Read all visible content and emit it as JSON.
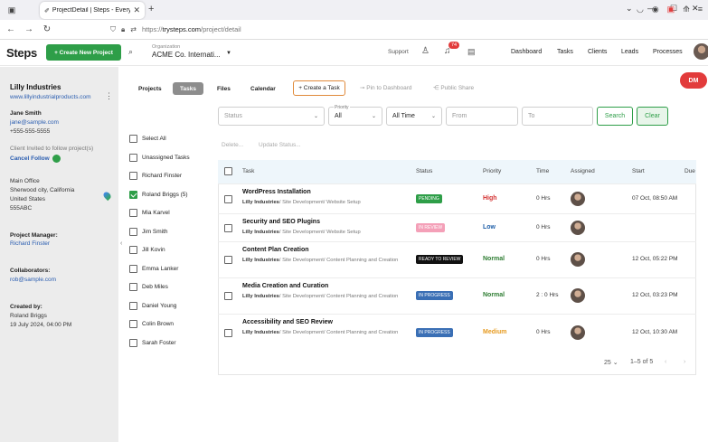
{
  "browser": {
    "tab_title": "ProjectDetail | Steps - Everythin",
    "url_prefix": "https://",
    "url_domain": "trysteps.com",
    "url_path": "/project/detail"
  },
  "header": {
    "logo": "Steps",
    "create_project": "+ Create New Project",
    "org_label": "Organization",
    "org_name": "ACME Co. Internati...",
    "support": "Support",
    "notif_count": "74",
    "nav": [
      "Dashboard",
      "Tasks",
      "Clients",
      "Leads",
      "Processes"
    ]
  },
  "sidebar": {
    "client_name": "Lilly Industries",
    "client_url": "www.lillyindustrialproducts.com",
    "contact_name": "Jane Smith",
    "contact_email": "jane@sample.com",
    "contact_phone": "+555-555-5555",
    "invite_note": "Client Invited to follow project(s)",
    "cancel_follow": "Cancel Follow",
    "address": [
      "Main Office",
      "Sherwood city, California",
      "United States",
      "555ABC"
    ],
    "pm_label": "Project Manager:",
    "pm_name": "Richard Finster",
    "collab_label": "Collaborators:",
    "collab_email": "rob@sample.com",
    "created_label": "Created by:",
    "created_name": "Roland Briggs",
    "created_date": "19 July 2024, 04:00 PM"
  },
  "project_tabs": [
    "Projects",
    "Tasks",
    "Files",
    "Calendar"
  ],
  "actions": {
    "create_task": "+ Create a Task",
    "pin": "Pin to Dashboard",
    "share": "Public Share"
  },
  "filters": {
    "status_placeholder": "Status",
    "priority_label": "Priority",
    "priority_value": "All",
    "time_value": "All Time",
    "from_placeholder": "From",
    "to_placeholder": "To",
    "search": "Search",
    "clear": "Clear"
  },
  "assignees": [
    {
      "name": "Select All",
      "checked": false
    },
    {
      "name": "Unassigned Tasks",
      "checked": false
    },
    {
      "name": "Richard Finster",
      "checked": false
    },
    {
      "name": "Roland Briggs (5)",
      "checked": true
    },
    {
      "name": "Mia Karvel",
      "checked": false
    },
    {
      "name": "Jim Smith",
      "checked": false
    },
    {
      "name": "Jill Kovin",
      "checked": false
    },
    {
      "name": "Emma Lanker",
      "checked": false
    },
    {
      "name": "Deb Miles",
      "checked": false
    },
    {
      "name": "Daniel Young",
      "checked": false
    },
    {
      "name": "Colin Brown",
      "checked": false
    },
    {
      "name": "Sarah Foster",
      "checked": false
    }
  ],
  "bulk": {
    "delete": "Delete...",
    "update": "Update Status..."
  },
  "table": {
    "columns": [
      "Task",
      "Status",
      "Priority",
      "Time",
      "Assigned",
      "Start",
      "Due"
    ],
    "rows": [
      {
        "title": "WordPress Installation",
        "client": "Lilly Industries",
        "path": "/ Site Development/ Website Setup",
        "status": "PENDING",
        "status_color": "#2e9e48",
        "priority": "High",
        "priority_color": "#d32f2f",
        "time": "0 Hrs",
        "start": "07 Oct, 08:50 AM"
      },
      {
        "title": "Security and SEO Plugins",
        "client": "Lilly Industries",
        "path": "/ Site Development/ Website Setup",
        "status": "IN REVIEW",
        "status_color": "#f4a0b8",
        "priority": "Low",
        "priority_color": "#1f5fa8",
        "time": "0 Hrs",
        "start": ""
      },
      {
        "title": "Content Plan Creation",
        "client": "Lilly Industries",
        "path": "/ Site Development/ Content Planning and Creation",
        "status": "READY TO REVIEW",
        "status_color": "#111111",
        "priority": "Normal",
        "priority_color": "#2e7d32",
        "time": "0 Hrs",
        "start": "12 Oct, 05:22 PM"
      },
      {
        "title": "Media Creation and Curation",
        "client": "Lilly Industries",
        "path": "/ Site Development/ Content Planning and Creation",
        "status": "IN PROGRESS",
        "status_color": "#3a6fb5",
        "priority": "Normal",
        "priority_color": "#2e7d32",
        "time": "2 : 0 Hrs",
        "start": "12 Oct, 03:23 PM"
      },
      {
        "title": "Accessibility and SEO Review",
        "client": "Lilly Industries",
        "path": "/ Site Development/ Content Planning and Creation",
        "status": "IN PROGRESS",
        "status_color": "#3a6fb5",
        "priority": "Medium",
        "priority_color": "#e69a1f",
        "time": "0 Hrs",
        "start": "12 Oct, 10:30 AM"
      }
    ]
  },
  "pagination": {
    "per_page": "25",
    "range": "1–5 of 5"
  },
  "chat_badge": "DM"
}
